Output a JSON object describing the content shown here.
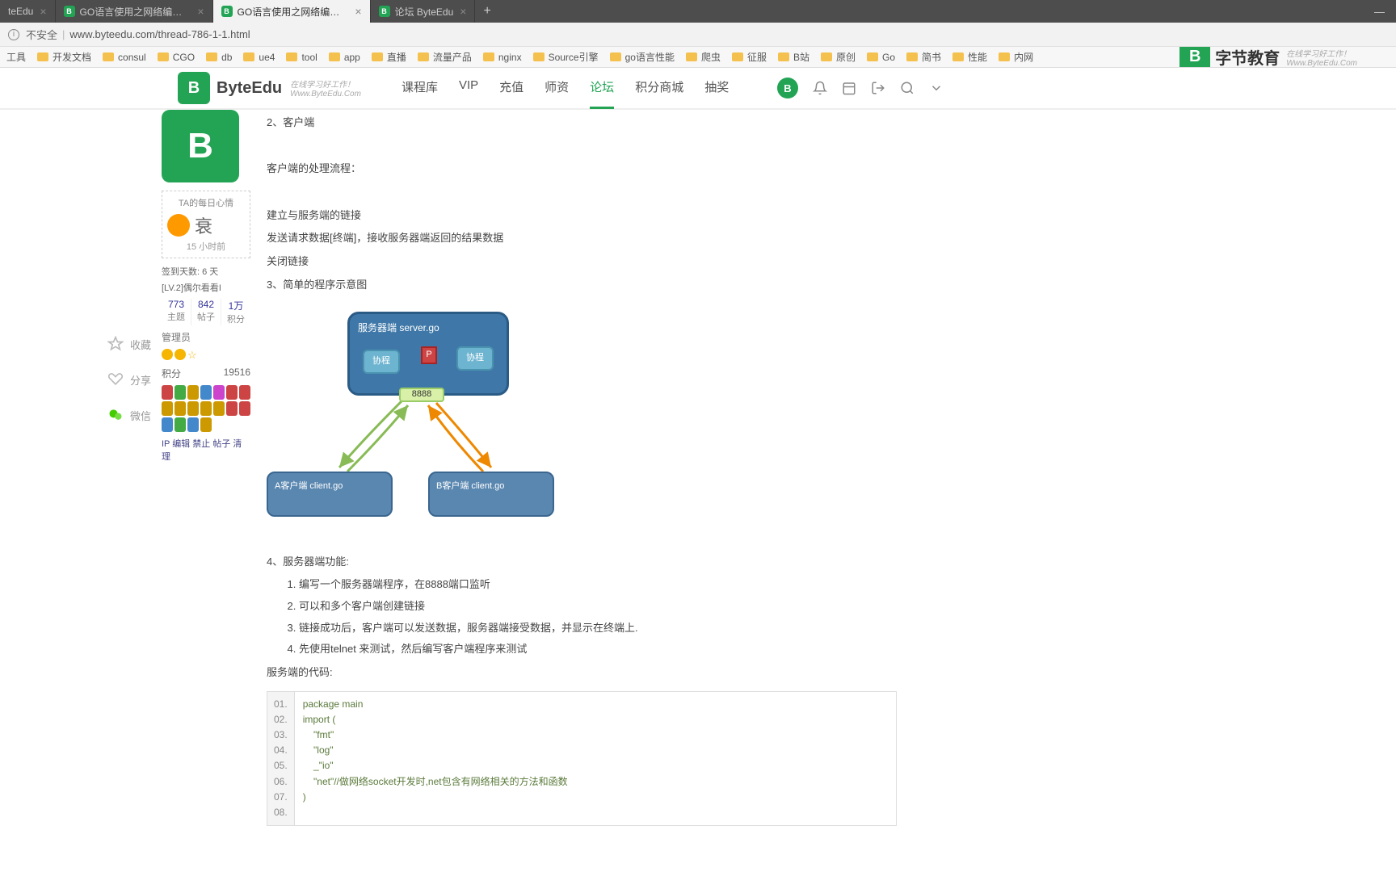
{
  "browser": {
    "tabs": [
      {
        "title": "teEdu",
        "closable": true
      },
      {
        "title": "GO语言使用之网络编程(TCP编…",
        "closable": true,
        "icon": true
      },
      {
        "title": "GO语言使用之网络编程(TCP编…",
        "closable": true,
        "icon": true,
        "active": true
      },
      {
        "title": "论坛 ByteEdu",
        "closable": true,
        "icon": true
      }
    ],
    "insecure": "不安全",
    "url": "www.byteedu.com/thread-786-1-1.html",
    "bookmarks": [
      "工具",
      "开发文档",
      "consul",
      "CGO",
      "db",
      "ue4",
      "tool",
      "app",
      "直播",
      "流量产品",
      "nginx",
      "Source引擎",
      "go语言性能",
      "爬虫",
      "征服",
      "B站",
      "原创",
      "Go",
      "简书",
      "性能",
      "内网"
    ]
  },
  "brand": {
    "name": "字节教育",
    "slogan_top": "在线学习好工作！",
    "slogan_bot": "Www.ByteEdu.Com"
  },
  "site": {
    "logo_text": "B",
    "name": "ByteEdu",
    "slogan_top": "在线学习好工作！",
    "slogan_bot": "Www.ByteEdu.Com",
    "nav": [
      "课程库",
      "VIP",
      "充值",
      "师资",
      "论坛",
      "积分商城",
      "抽奖"
    ],
    "nav_active_index": 4
  },
  "side_actions": {
    "fav": "收藏",
    "share": "分享",
    "wechat": "微信"
  },
  "user": {
    "mood_title": "TA的每日心情",
    "mood_char": "衰",
    "mood_time": "15 小时前",
    "sign_line": "签到天数: 6 天",
    "lv_line": "[LV.2]偶尔看看I",
    "stats": [
      {
        "n": "773",
        "l": "主题"
      },
      {
        "n": "842",
        "l": "帖子"
      },
      {
        "n": "1万",
        "l": "积分"
      }
    ],
    "role": "管理员",
    "score_label": "积分",
    "score_value": "19516",
    "admin_links": "IP 编辑 禁止 帖子 清理"
  },
  "post": {
    "p1": "2、客户端",
    "p2": "客户端的处理流程：",
    "p3": "建立与服务端的链接",
    "p4": "发送请求数据[终端]，接收服务器端返回的结果数据",
    "p5": "关闭链接",
    "p6": "3、简单的程序示意图",
    "diagram": {
      "server": "服务器端  server.go",
      "coroutine": "协程",
      "p": "P",
      "port": "8888",
      "client_a": "A客户端  client.go",
      "client_b": "B客户端  client.go"
    },
    "p7": "4、服务器端功能:",
    "ol": [
      "编写一个服务器端程序，在8888端口监听",
      "可以和多个客户端创建链接",
      "链接成功后，客户端可以发送数据，服务器端接受数据，并显示在终端上.",
      "先使用telnet 来测试，然后编写客户端程序来测试"
    ],
    "p8": "服务端的代码:",
    "code": [
      "package main",
      "",
      "import (",
      "    \"fmt\"",
      "    \"log\"",
      "    _\"io\"",
      "    \"net\"//做网络socket开发时,net包含有网络相关的方法和函数",
      ")"
    ]
  }
}
